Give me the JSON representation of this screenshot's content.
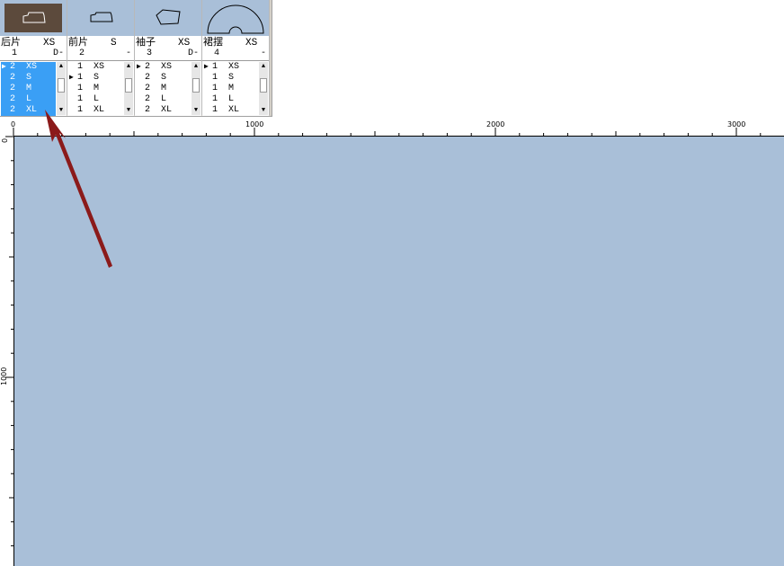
{
  "pieces": [
    {
      "name": "后片",
      "default_size": "XS",
      "number": "1",
      "flag": "D-",
      "rows": [
        {
          "qty": "2",
          "size": "XS",
          "pointer": true
        },
        {
          "qty": "2",
          "size": "S"
        },
        {
          "qty": "2",
          "size": "M"
        },
        {
          "qty": "2",
          "size": "L"
        },
        {
          "qty": "2",
          "size": "XL"
        }
      ]
    },
    {
      "name": "前片",
      "default_size": "S",
      "number": "2",
      "flag": "-",
      "rows": [
        {
          "qty": "1",
          "size": "XS"
        },
        {
          "qty": "1",
          "size": "S",
          "pointer": true
        },
        {
          "qty": "1",
          "size": "M"
        },
        {
          "qty": "1",
          "size": "L"
        },
        {
          "qty": "1",
          "size": "XL"
        }
      ]
    },
    {
      "name": "袖子",
      "default_size": "XS",
      "number": "3",
      "flag": "D-",
      "rows": [
        {
          "qty": "2",
          "size": "XS",
          "pointer": true
        },
        {
          "qty": "2",
          "size": "S"
        },
        {
          "qty": "2",
          "size": "M"
        },
        {
          "qty": "2",
          "size": "L"
        },
        {
          "qty": "2",
          "size": "XL"
        }
      ]
    },
    {
      "name": "裙摆",
      "default_size": "XS",
      "number": "4",
      "flag": "-",
      "rows": [
        {
          "qty": "1",
          "size": "XS",
          "pointer": true
        },
        {
          "qty": "1",
          "size": "S"
        },
        {
          "qty": "1",
          "size": "M"
        },
        {
          "qty": "1",
          "size": "L"
        },
        {
          "qty": "1",
          "size": "XL"
        }
      ]
    }
  ],
  "ruler": {
    "horizontal_labels": [
      "0",
      "1000",
      "2000",
      "3000"
    ],
    "vertical_labels": [
      "0",
      "1000"
    ]
  },
  "colors": {
    "canvas": "#a9bfd8",
    "selection": "#3a9ff5",
    "selected_thumbnail": "#5c4a3c",
    "arrow": "#8b1a1a"
  }
}
